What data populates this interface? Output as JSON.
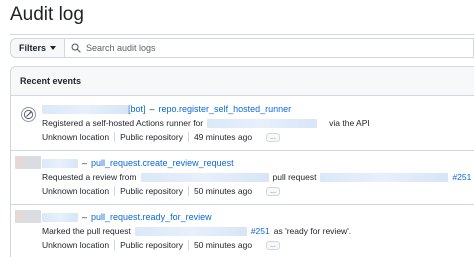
{
  "header": {
    "title": "Audit log"
  },
  "toolbar": {
    "filters_label": "Filters",
    "search_placeholder": "Search audit logs"
  },
  "events_section": {
    "title": "Recent events"
  },
  "events": [
    {
      "actor_suffix": "[bot]",
      "separator": "–",
      "action": "repo.register_self_hosted_runner",
      "description_before": "Registered a self-hosted Actions runner for",
      "description_after": "via the API",
      "location": "Unknown location",
      "visibility": "Public repository",
      "time": "49 minutes ago",
      "more_label": "..."
    },
    {
      "separator": "–",
      "action": "pull_request.create_review_request",
      "description_before": "Requested a review from",
      "description_middle": "pull request",
      "pr_number": "#251",
      "location": "Unknown location",
      "visibility": "Public repository",
      "time": "50 minutes ago",
      "more_label": "..."
    },
    {
      "separator": "–",
      "action": "pull_request.ready_for_review",
      "description_before": "Marked the pull request",
      "pr_number": "#251",
      "description_after": "as 'ready for review'.",
      "location": "Unknown location",
      "visibility": "Public repository",
      "time": "50 minutes ago",
      "more_label": "..."
    }
  ]
}
